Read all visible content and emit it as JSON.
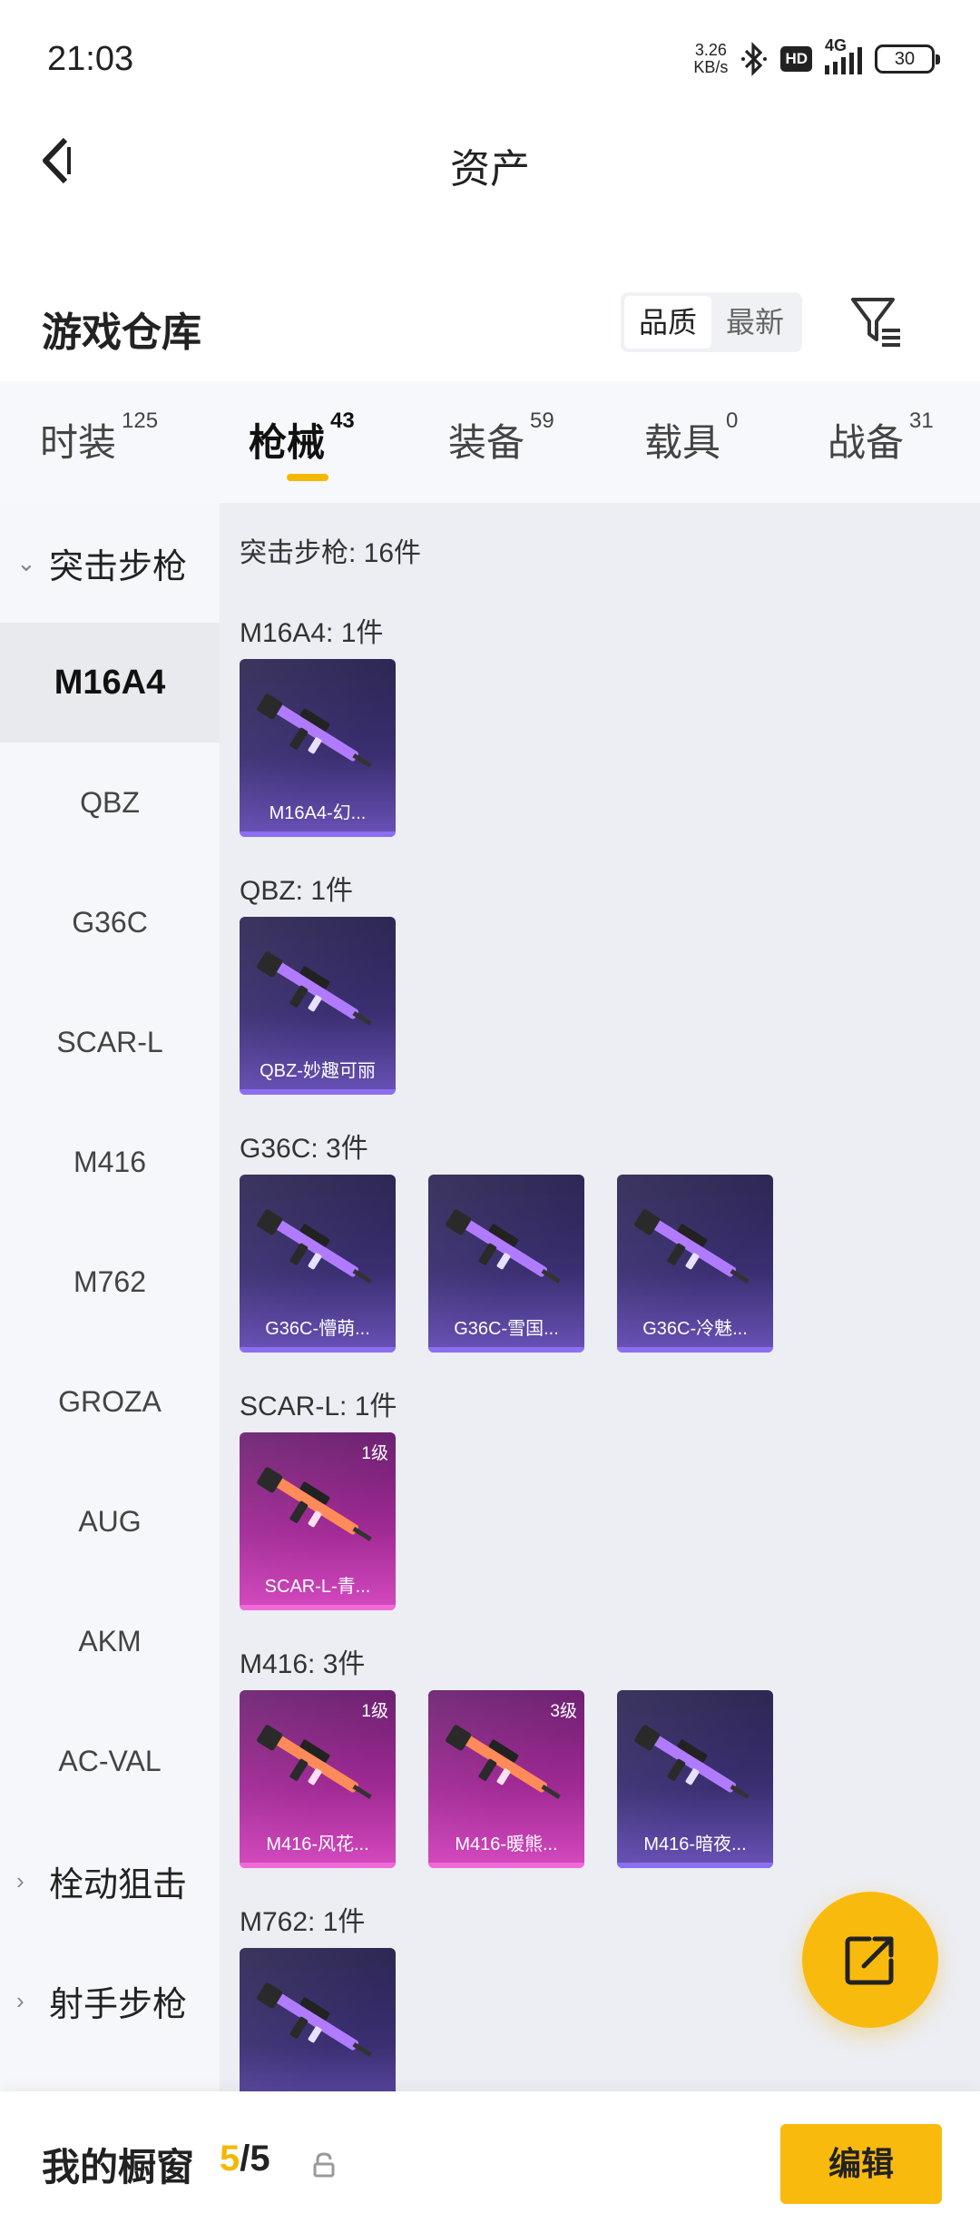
{
  "status_bar": {
    "time": "21:03",
    "net_speed_value": "3.26",
    "net_speed_unit": "KB/s",
    "hd_label": "HD",
    "network_label": "4G",
    "battery": "30"
  },
  "header": {
    "title": "资产",
    "back_icon": "back-arrow-icon"
  },
  "warehouse": {
    "title": "游戏仓库",
    "sort_options": [
      "品质",
      "最新"
    ],
    "sort_selected": "品质",
    "filter_icon": "filter-icon"
  },
  "tabs": [
    {
      "label": "时装",
      "count": "125"
    },
    {
      "label": "枪械",
      "count": "43"
    },
    {
      "label": "装备",
      "count": "59"
    },
    {
      "label": "载具",
      "count": "0"
    },
    {
      "label": "战备",
      "count": "31"
    }
  ],
  "active_tab": "枪械",
  "sidebar": {
    "group_assault": "突击步枪",
    "items": [
      "M16A4",
      "QBZ",
      "G36C",
      "SCAR-L",
      "M416",
      "M762",
      "GROZA",
      "AUG",
      "AKM",
      "AC-VAL"
    ],
    "active_item": "M16A4",
    "group_bolt": "栓动狙击",
    "group_marksman": "射手步枪"
  },
  "content": {
    "category_header": "突击步枪: 16件",
    "sections": [
      {
        "label": "M16A4: 1件",
        "items": [
          {
            "name": "M16A4-幻...",
            "level": "",
            "rarity": "purple"
          }
        ]
      },
      {
        "label": "QBZ: 1件",
        "items": [
          {
            "name": "QBZ-妙趣可丽",
            "level": "",
            "rarity": "purple"
          }
        ]
      },
      {
        "label": "G36C: 3件",
        "items": [
          {
            "name": "G36C-懵萌...",
            "level": "",
            "rarity": "purple"
          },
          {
            "name": "G36C-雪国...",
            "level": "",
            "rarity": "purple"
          },
          {
            "name": "G36C-冷魅...",
            "level": "",
            "rarity": "purple"
          }
        ]
      },
      {
        "label": "SCAR-L: 1件",
        "items": [
          {
            "name": "SCAR-L-青...",
            "level": "1级",
            "rarity": "pink"
          }
        ]
      },
      {
        "label": "M416: 3件",
        "items": [
          {
            "name": "M416-风花...",
            "level": "1级",
            "rarity": "pink"
          },
          {
            "name": "M416-暖熊...",
            "level": "3级",
            "rarity": "pink"
          },
          {
            "name": "M416-暗夜...",
            "level": "",
            "rarity": "purple"
          }
        ]
      },
      {
        "label": "M762: 1件",
        "items": [
          {
            "name": "",
            "level": "",
            "rarity": "purple"
          }
        ]
      }
    ]
  },
  "fab_icon": "share-external-icon",
  "bottom_bar": {
    "showcase_label": "我的橱窗",
    "showcase_current": "5",
    "showcase_separator": "/",
    "showcase_max": "5",
    "edit_button": "编辑"
  },
  "colors": {
    "accent": "#f9ba0e",
    "purple_rarity": "#3b2f72",
    "pink_rarity": "#a12a95"
  }
}
